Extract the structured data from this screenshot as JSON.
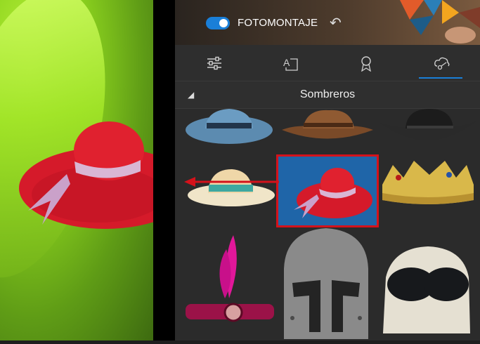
{
  "banner": {
    "mode_label": "FOTOMONTAJE",
    "toggle_on": true
  },
  "tabs": [
    {
      "name": "adjustments",
      "icon": "sliders-icon"
    },
    {
      "name": "text",
      "icon": "text-icon"
    },
    {
      "name": "badge",
      "icon": "ribbon-icon"
    },
    {
      "name": "stickers",
      "icon": "cloud-draw-icon",
      "active": true
    }
  ],
  "section": {
    "title": "Sombreros"
  },
  "stickers": [
    {
      "id": "blue-fedora"
    },
    {
      "id": "brown-cowboy-hat"
    },
    {
      "id": "black-cowboy-hat"
    },
    {
      "id": "straw-hat"
    },
    {
      "id": "red-sun-hat",
      "selected": true
    },
    {
      "id": "gold-crown"
    },
    {
      "id": "pink-feather-headband"
    },
    {
      "id": "knight-helmet"
    },
    {
      "id": "aviator-helmet-goggles"
    }
  ],
  "colors": {
    "accent": "#1a7fd8",
    "highlight": "#d4121b"
  }
}
